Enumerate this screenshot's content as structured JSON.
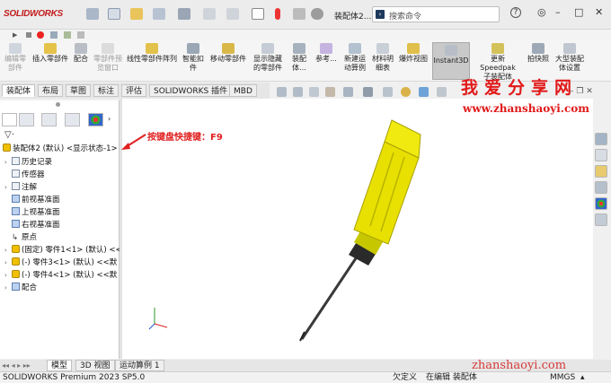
{
  "app": {
    "logo": "SOLIDWORKS",
    "doc_title": "装配体2....",
    "search_placeholder": "搜索命令",
    "help": "?",
    "user": "◎"
  },
  "command_buttons": [
    {
      "label": "编辑零\n部件",
      "disabled": true
    },
    {
      "label": "插入零部件",
      "disabled": false
    },
    {
      "label": "配合",
      "disabled": false
    },
    {
      "label": "零部件预\n览窗口",
      "disabled": true
    },
    {
      "label": "线性零部件阵列",
      "disabled": false
    },
    {
      "label": "智能扣\n件",
      "disabled": false
    },
    {
      "label": "移动零部件",
      "disabled": false
    },
    {
      "label": "显示隐藏\n的零部件",
      "disabled": false
    },
    {
      "label": "装配体...",
      "disabled": false
    },
    {
      "label": "参考...",
      "disabled": false
    },
    {
      "label": "新建运\n动算例",
      "disabled": false
    },
    {
      "label": "材料明\n细表",
      "disabled": false
    },
    {
      "label": "爆炸视图",
      "disabled": false
    },
    {
      "label": "Instant3D",
      "disabled": false,
      "active": true
    },
    {
      "label": "更新 Speedpak\n子装配体",
      "disabled": false
    },
    {
      "label": "拍快照",
      "disabled": false
    },
    {
      "label": "大型装配\n体设置",
      "disabled": false
    }
  ],
  "tabs": [
    "装配体",
    "布局",
    "草图",
    "标注",
    "评估",
    "SOLIDWORKS 插件",
    "MBD"
  ],
  "tree": {
    "root": "装配体2 (默认) <显示状态-1>",
    "items": [
      "历史记录",
      "传感器",
      "注解",
      "前视基准面",
      "上视基准面",
      "右视基准面",
      "原点",
      "(固定) 零件1<1> (默认) <<",
      "(-) 零件3<1> (默认) <<默",
      "(-) 零件4<1> (默认) <<默",
      "配合"
    ]
  },
  "annotation": "按键盘快捷键：F9",
  "watermark": {
    "title": "我爱分享网",
    "url": "www.zhanshaoyi.com",
    "url_bottom": "zhanshaoyi.com"
  },
  "bottom_tabs": [
    "模型",
    "3D 视图",
    "运动算例 1"
  ],
  "status": {
    "app": "SOLIDWORKS Premium 2023 SP5.0",
    "define": "欠定义",
    "editing": "在编辑 装配体",
    "units": "MMGS"
  },
  "colors": {
    "accent_red": "#e11919",
    "handle_yellow": "#e8e000"
  }
}
